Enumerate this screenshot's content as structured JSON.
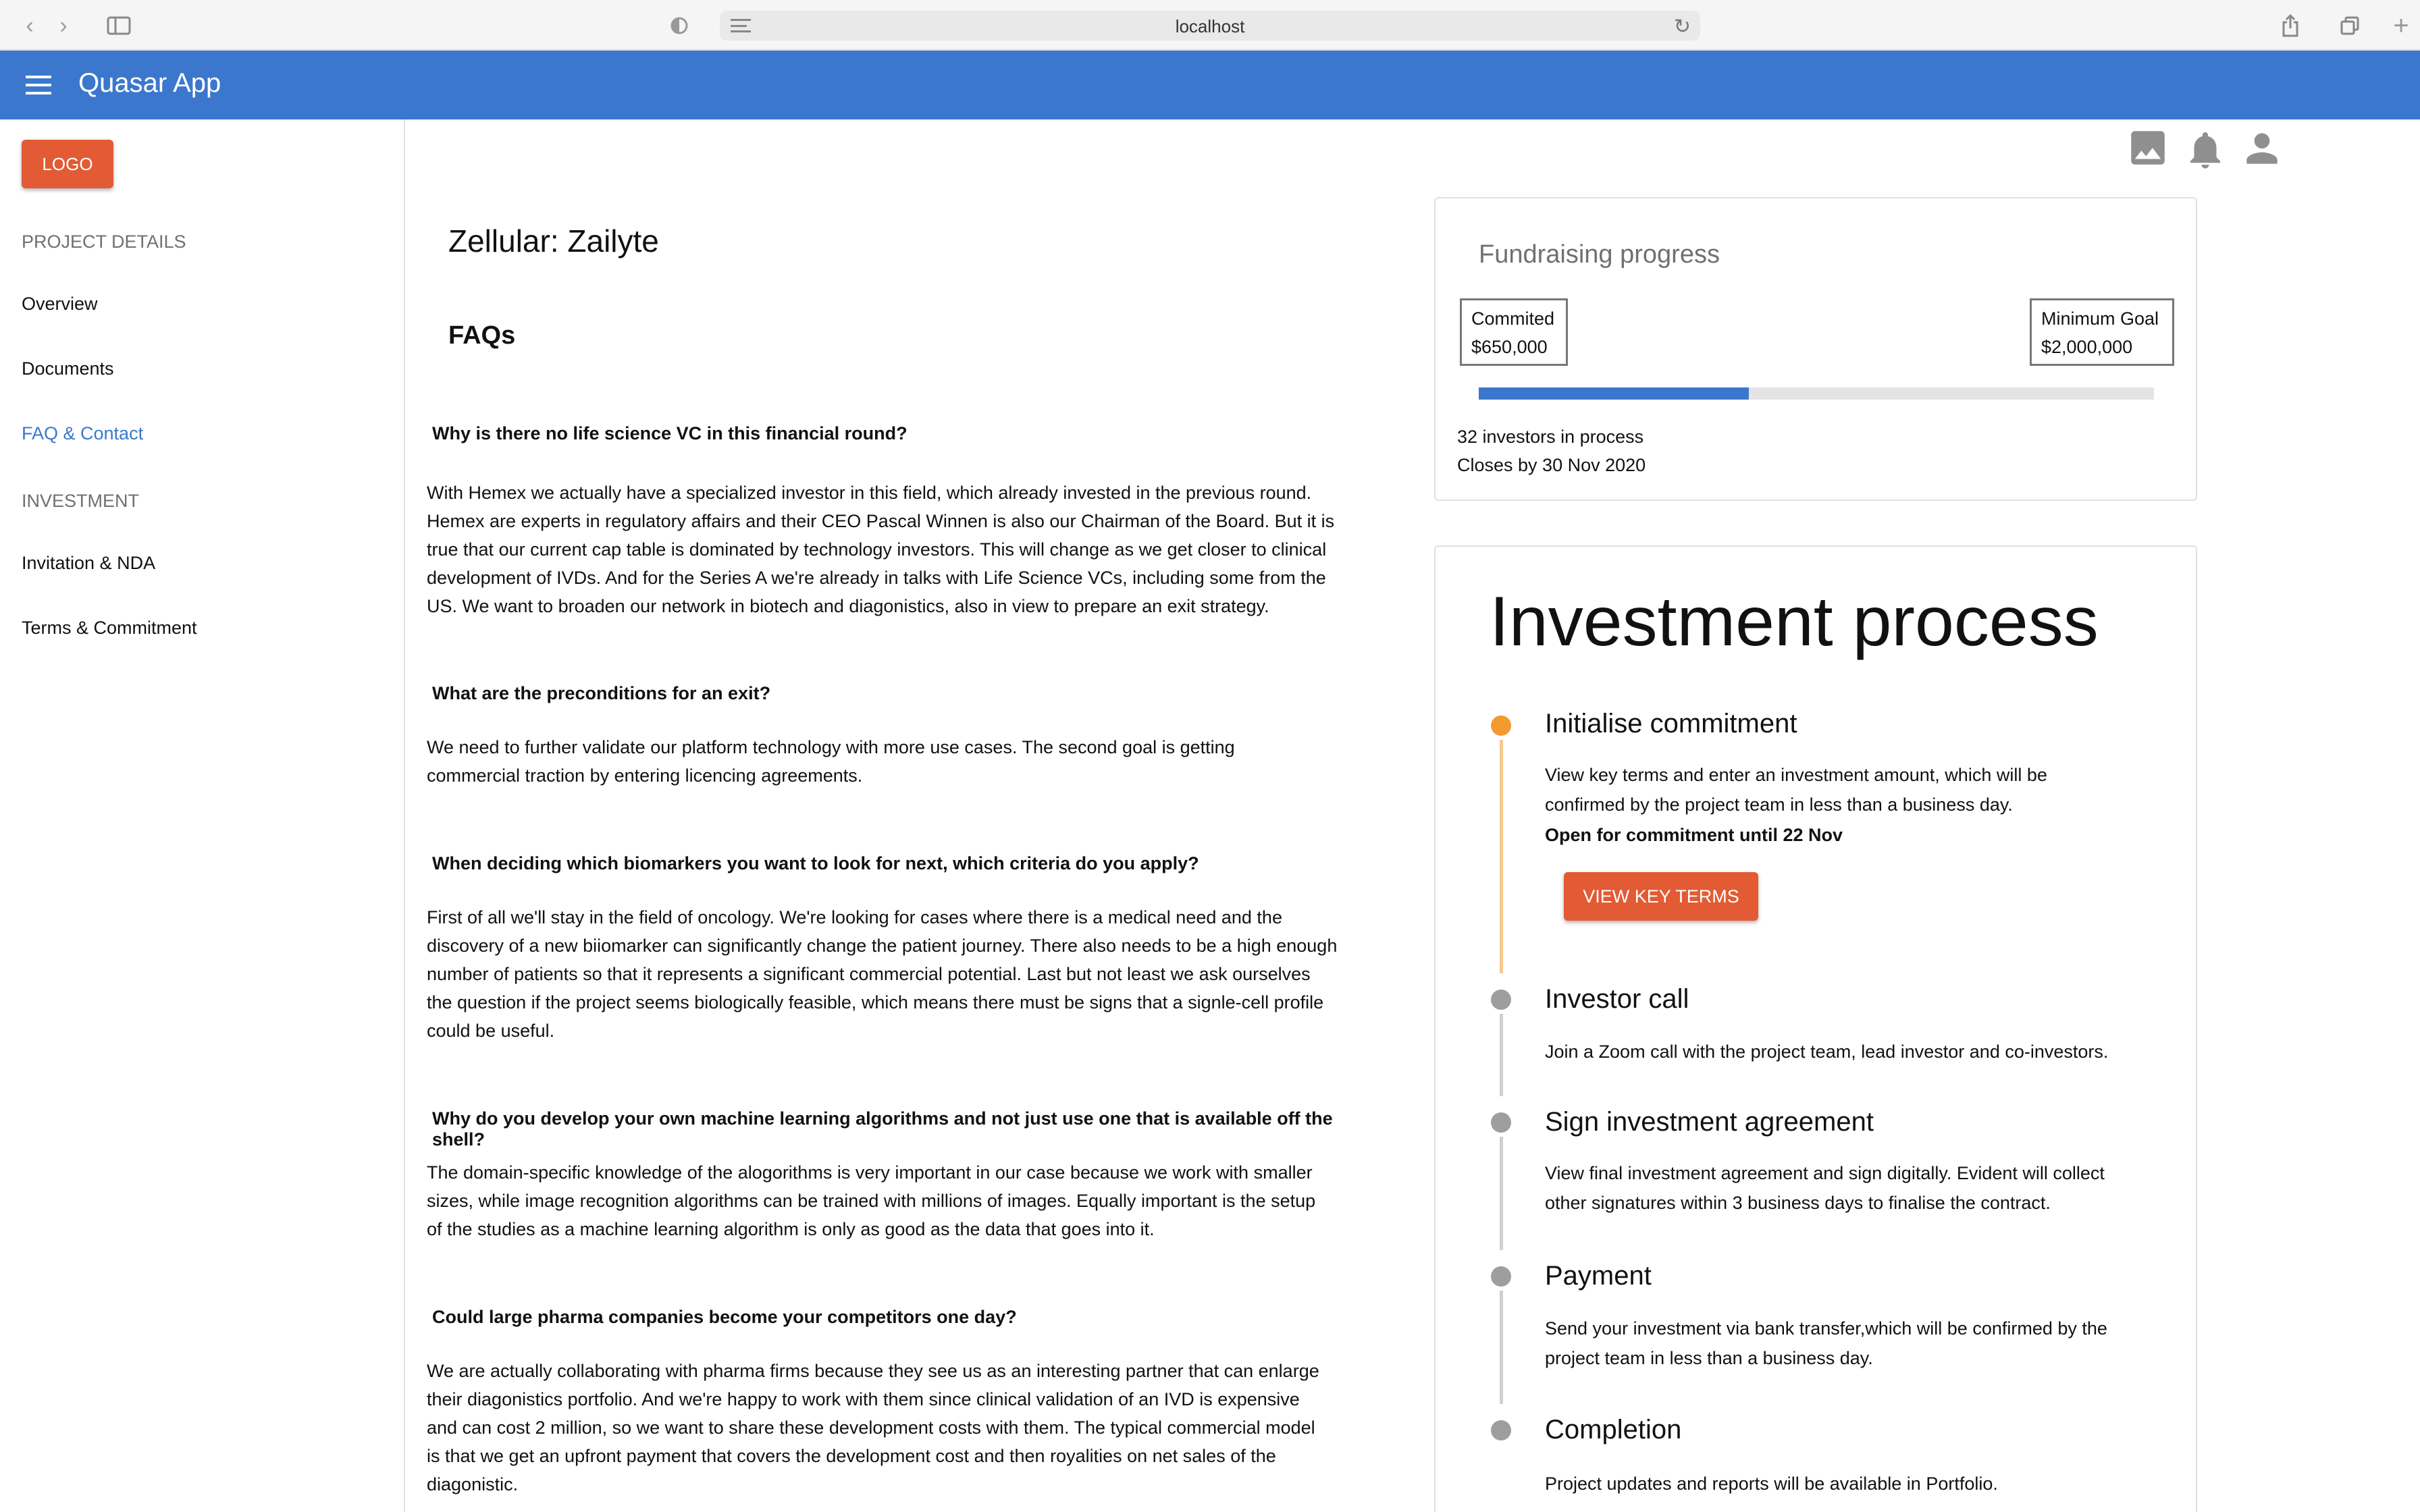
{
  "browser": {
    "url": "localhost"
  },
  "app": {
    "title": "Quasar App"
  },
  "sidebar": {
    "logo_label": "LOGO",
    "sections": [
      {
        "header": "PROJECT DETAILS",
        "items": [
          "Overview",
          "Documents",
          "FAQ & Contact"
        ]
      },
      {
        "header": "INVESTMENT",
        "items": [
          "Invitation & NDA",
          "Terms & Commitment"
        ]
      }
    ],
    "active_item": "FAQ & Contact"
  },
  "header_icons": [
    "image-icon",
    "bell-icon",
    "person-icon"
  ],
  "main": {
    "project_title": "Zellular: Zailyte",
    "faq_heading": "FAQs",
    "faqs": [
      {
        "question": "Why is there no life science VC in this financial round?",
        "answer_lines": [
          "With Hemex we actually have a specialized investor in this field, which already invested in the previous round.",
          "Hemex are experts in regulatory affairs and their CEO Pascal Winnen is also our Chairman of the Board. But it is",
          "true that our current cap table is dominated by technology investors. This will change as we get closer to clinical",
          "development of IVDs. And for the Series A we're already in talks with Life Science VCs, including some from the",
          "US. We want to broaden our network in biotech and diagonistics, also in view to prepare an exit strategy."
        ]
      },
      {
        "question": "What are the preconditions for an exit?",
        "answer_lines": [
          "We need to further validate our platform technology with more use cases. The second goal is getting",
          "commercial traction by entering licencing agreements."
        ]
      },
      {
        "question": "When deciding which biomarkers you want to look for next, which criteria do you apply?",
        "answer_lines": [
          "First of all we'll stay in the field of oncology. We're looking for cases where there is a medical need and the",
          "discovery of a new biiomarker can significantly change the patient journey. There also needs to be a high enough",
          "number of patients so that it represents a significant commercial potential. Last but not least we ask ourselves",
          "the question if the project seems biologically feasible, which means there must be signs that a signle-cell profile",
          "could be useful."
        ]
      },
      {
        "question": "Why do you develop your own machine learning algorithms and not just use one that is available off the shell?",
        "answer_lines": [
          "The domain-specific knowledge of the alogorithms is very important in our case because we work with smaller",
          "sizes, while image recognition algorithms can be trained with millions of images. Equally important is the setup",
          "of the studies as a machine learning algorithm is only as good as the data that goes into it."
        ]
      },
      {
        "question": "Could large pharma companies become your competitors one day?",
        "answer_lines": [
          "We are actually collaborating with pharma firms because they see us as an interesting partner that can enlarge",
          "their diagonistics portfolio. And we're happy to work with them since clinical validation of an IVD is expensive",
          "and can cost 2 million, so we want to share these development costs with them. The typical commercial model",
          "is that we get an upfront payment that covers the development cost and then royalities on net sales of the",
          "diagonistic."
        ]
      }
    ]
  },
  "fundraising": {
    "title": "Fundraising progress",
    "committed_label": "Commited",
    "committed_value": "$650,000",
    "goal_label": "Minimum Goal",
    "goal_value": "$2,000,000",
    "progress_fraction": 0.4,
    "investors_text": "32 investors in process",
    "closes_text": "Closes by 30 Nov 2020"
  },
  "process": {
    "title": "Investment process",
    "steps": [
      {
        "title": "Initialise commitment",
        "desc_lines": [
          "View key terms and enter an investment amount, which will be",
          "confirmed by the project team in less than a business day."
        ],
        "bold": "Open for commitment until 22 Nov",
        "button": "VIEW KEY TERMS",
        "active": true
      },
      {
        "title": "Investor call",
        "desc_lines": [
          "Join a Zoom call with the project team, lead investor and co-investors."
        ]
      },
      {
        "title": "Sign investment agreement",
        "desc_lines": [
          "View final investment agreement and sign digitally. Evident will collect",
          "other signatures within 3 business days to finalise the contract."
        ]
      },
      {
        "title": "Payment",
        "desc_lines": [
          "Send your investment via bank transfer,which will be confirmed by the",
          "project team in less than a business day."
        ]
      },
      {
        "title": "Completion",
        "desc_lines": [
          "Project updates and reports will be available in Portfolio."
        ]
      }
    ]
  },
  "colors": {
    "primary": "#3b78cd",
    "accent": "#e25b34",
    "active_step": "#f29a30"
  }
}
